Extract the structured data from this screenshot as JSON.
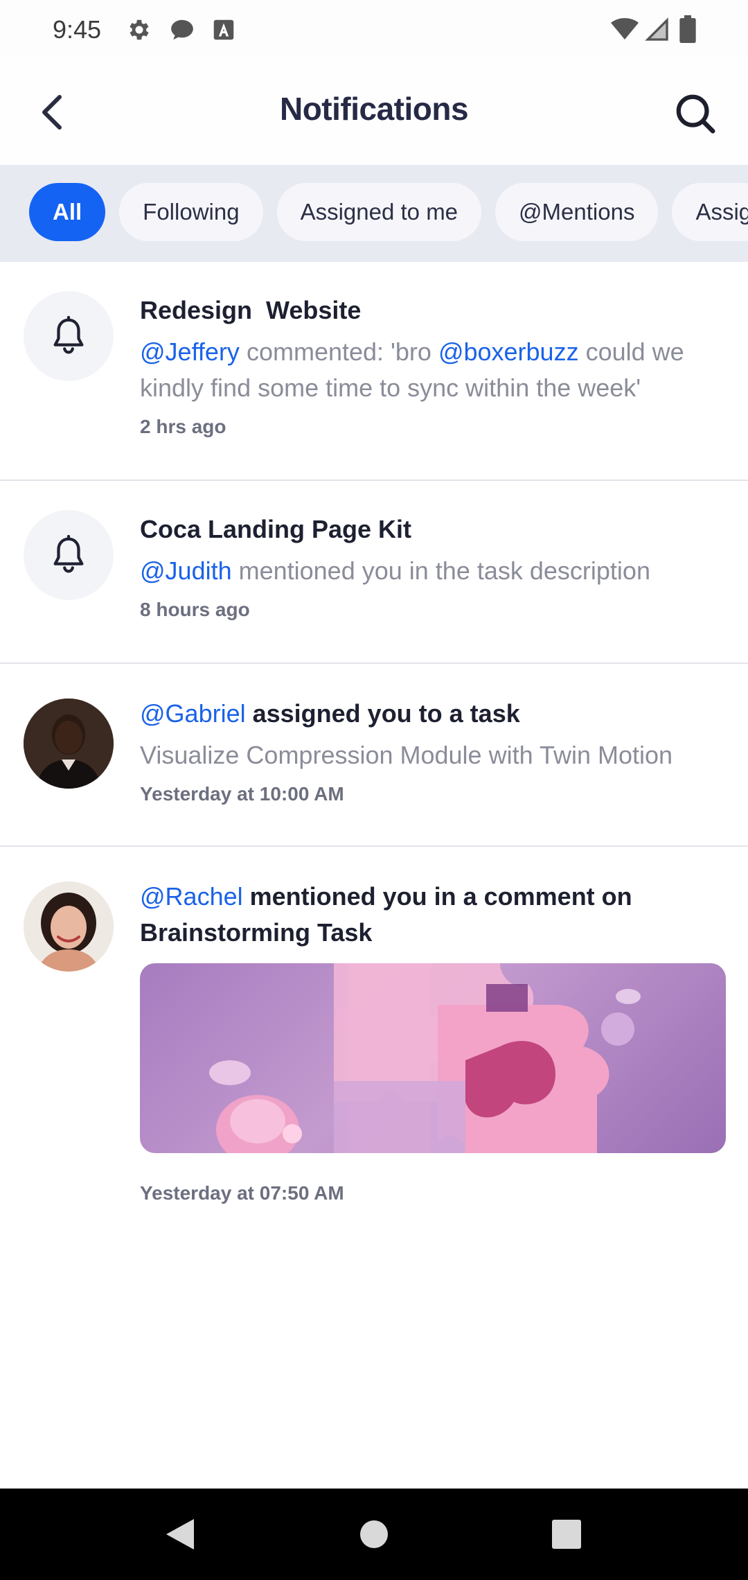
{
  "status_bar": {
    "time": "9:45",
    "left_icons": [
      "gear-icon",
      "chat-bubble-icon",
      "text-a-icon"
    ],
    "right_icons": [
      "wifi-icon",
      "signal-icon",
      "battery-icon"
    ]
  },
  "app_bar": {
    "title": "Notifications",
    "back_icon": "chevron-left-icon",
    "search_icon": "search-icon"
  },
  "filters": {
    "chips": [
      {
        "label": "All",
        "active": true
      },
      {
        "label": "Following",
        "active": false
      },
      {
        "label": "Assigned to me",
        "active": false
      },
      {
        "label": "@Mentions",
        "active": false
      },
      {
        "label": "Assig",
        "active": false
      }
    ]
  },
  "notifications": [
    {
      "icon": "bell-icon",
      "title": "Redesign  Website",
      "mention_1": "@Jeffery",
      "text_1": " commented: 'bro ",
      "mention_2": "@boxerbuzz",
      "text_2": " could we kindly find some time to sync within the week'",
      "time": "2 hrs ago"
    },
    {
      "icon": "bell-icon",
      "title": "Coca Landing Page Kit",
      "mention_1": "@Judith",
      "text_1": " mentioned you in the task description",
      "time": "8 hours ago"
    },
    {
      "avatar": "user-avatar-gabriel",
      "title_mention": "@Gabriel",
      "title_text": " assigned you to a task",
      "body": "Visualize Compression Module with Twin Motion",
      "time": "Yesterday at 10:00 AM"
    },
    {
      "avatar": "user-avatar-rachel",
      "title_mention": "@Rachel",
      "title_text": " mentioned you in a comment on Brainstorming Task",
      "image": "puzzle-pieces-image",
      "time": "Yesterday at 07:50 AM"
    }
  ],
  "nav_bar": {
    "icons": [
      "nav-back-icon",
      "nav-home-icon",
      "nav-recents-icon"
    ]
  },
  "colors": {
    "accent": "#1463f3",
    "mention": "#1a62e8",
    "chip_bar_bg": "#e8eaf2",
    "title_text": "#262a45"
  }
}
